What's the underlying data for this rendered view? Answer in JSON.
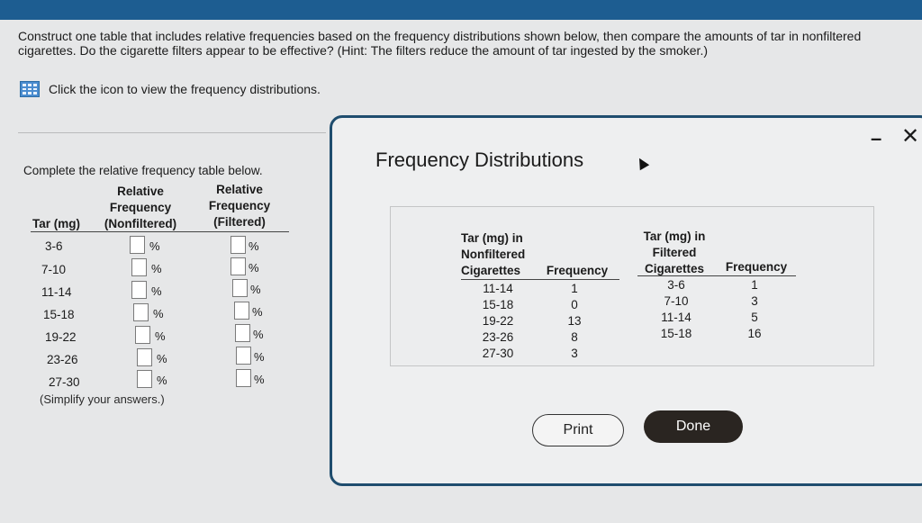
{
  "question": "Construct one table that includes relative frequencies based on the frequency distributions shown below, then compare the amounts of tar in nonfiltered cigarettes. Do the cigarette filters appear to be effective? (Hint: The filters reduce the amount of tar ingested by the smoker.)",
  "icon_link": "Click the icon to view the frequency distributions.",
  "left": {
    "instruction": "Complete the relative frequency table below.",
    "col_tar": "Tar (mg)",
    "col_nonfiltered": [
      "Relative",
      "Frequency",
      "(Nonfiltered)"
    ],
    "col_filtered": [
      "Relative",
      "Frequency",
      "(Filtered)"
    ],
    "rows": [
      "3-6",
      "7-10",
      "11-14",
      "15-18",
      "19-22",
      "23-26",
      "27-30"
    ],
    "percent": "%",
    "note": "(Simplify your answers.)"
  },
  "dialog": {
    "title": "Frequency Distributions",
    "nonfiltered_header": [
      "Tar (mg) in",
      "Nonfiltered",
      "Cigarettes"
    ],
    "filtered_header": [
      "Tar (mg) in",
      "Filtered",
      "Cigarettes"
    ],
    "frequency_label": "Frequency",
    "nonfiltered_rows": [
      [
        "11-14",
        "1"
      ],
      [
        "15-18",
        "0"
      ],
      [
        "19-22",
        "13"
      ],
      [
        "23-26",
        "8"
      ],
      [
        "27-30",
        "3"
      ]
    ],
    "filtered_rows": [
      [
        "3-6",
        "1"
      ],
      [
        "7-10",
        "3"
      ],
      [
        "11-14",
        "5"
      ],
      [
        "15-18",
        "16"
      ]
    ],
    "print_label": "Print",
    "done_label": "Done",
    "minimize": "–",
    "close": "✕"
  }
}
